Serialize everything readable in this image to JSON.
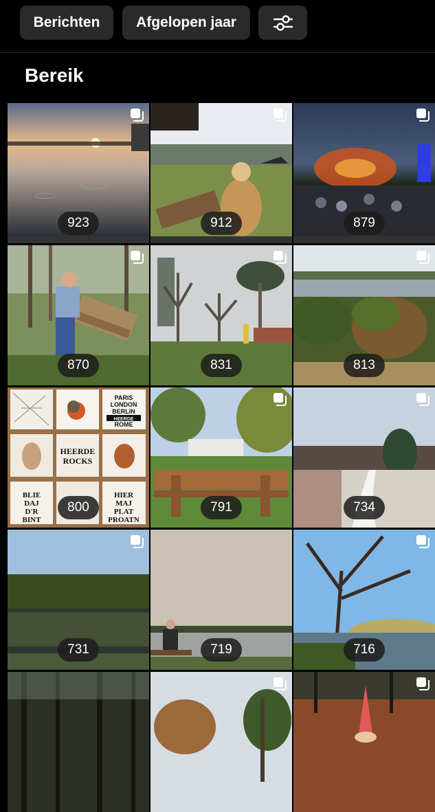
{
  "filters": {
    "type_label": "Berichten",
    "period_label": "Afgelopen jaar",
    "settings_icon": "sliders-icon"
  },
  "section_title": "Bereik",
  "posts": [
    {
      "reach": "923",
      "scene": "sunset-lake"
    },
    {
      "reach": "912",
      "scene": "terrace-river"
    },
    {
      "reach": "879",
      "scene": "night-concert"
    },
    {
      "reach": "870",
      "scene": "forest-bench-man"
    },
    {
      "reach": "831",
      "scene": "park-trees"
    },
    {
      "reach": "813",
      "scene": "pond-shrubs"
    },
    {
      "reach": "800",
      "scene": "tile-collage"
    },
    {
      "reach": "791",
      "scene": "wooden-bench-villa"
    },
    {
      "reach": "734",
      "scene": "snowy-path"
    },
    {
      "reach": "731",
      "scene": "forest-lake-reflection"
    },
    {
      "reach": "719",
      "scene": "man-on-bench-lake"
    },
    {
      "reach": "716",
      "scene": "autumn-tree-lake"
    },
    {
      "reach": "",
      "scene": "dark-pines"
    },
    {
      "reach": "",
      "scene": "autumn-treetops"
    },
    {
      "reach": "",
      "scene": "gnome-leaves"
    }
  ],
  "collage_text": {
    "cities": "PARIS\nLONDON\nBERLIN\nHEERDE\nROME\nMADRID",
    "heerde_rocks": "HEERDE\nROCKS",
    "blie_daj": "BLIE\nDAJ\nD'R\nBINT",
    "hier_maj": "HIER\nMAJ\nPLAT\nPROATN"
  }
}
